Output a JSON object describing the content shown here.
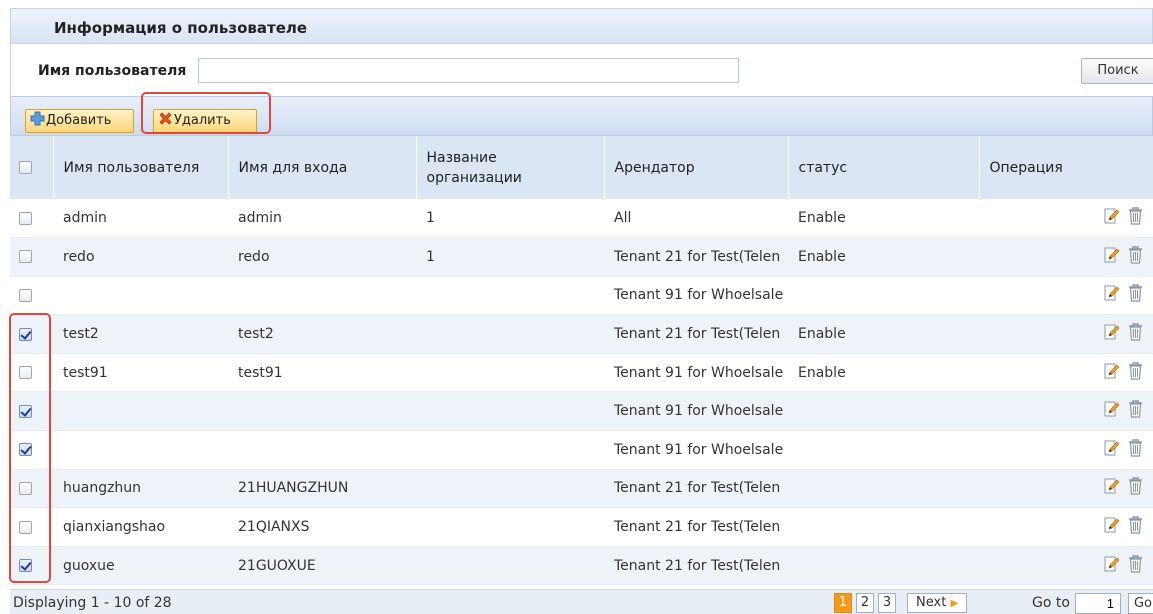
{
  "panel": {
    "title": "Информация о пользователе"
  },
  "search": {
    "label": "Имя пользователя",
    "value": "",
    "placeholder": "",
    "button": "Поиск"
  },
  "toolbar": {
    "add_label": "Добавить",
    "delete_label": "Удалить"
  },
  "columns": [
    "Имя пользователя",
    "Имя для входа",
    "Название организации",
    "Арендатор",
    "статус",
    "Операция"
  ],
  "rows": [
    {
      "checked": false,
      "name": "admin",
      "login": "admin",
      "org": "1",
      "tenant": "All",
      "status": "Enable"
    },
    {
      "checked": false,
      "name": "redo",
      "login": "redo",
      "org": "1",
      "tenant": "Tenant 21 for Test(Telen",
      "status": "Enable"
    },
    {
      "checked": false,
      "name": "",
      "login": "",
      "org": "",
      "tenant": "Tenant 91 for Whoelsale",
      "status": ""
    },
    {
      "checked": true,
      "name": "test2",
      "login": "test2",
      "org": "",
      "tenant": "Tenant 21 for Test(Telen",
      "status": "Enable"
    },
    {
      "checked": false,
      "name": "test91",
      "login": "test91",
      "org": "",
      "tenant": "Tenant 91 for Whoelsale",
      "status": "Enable"
    },
    {
      "checked": true,
      "name": "",
      "login": "",
      "org": "",
      "tenant": "Tenant 91 for Whoelsale",
      "status": ""
    },
    {
      "checked": true,
      "name": "",
      "login": "",
      "org": "",
      "tenant": "Tenant 91 for Whoelsale",
      "status": ""
    },
    {
      "checked": false,
      "name": "huangzhun",
      "login": "21HUANGZHUN",
      "org": "",
      "tenant": "Tenant 21 for Test(Telen",
      "status": ""
    },
    {
      "checked": false,
      "name": "qianxiangshao",
      "login": "21QIANXS",
      "org": "",
      "tenant": "Tenant 21 for Test(Telen",
      "status": ""
    },
    {
      "checked": true,
      "name": "guoxue",
      "login": "21GUOXUE",
      "org": "",
      "tenant": "Tenant 21 for Test(Telen",
      "status": ""
    }
  ],
  "footer": {
    "displaying": "Displaying 1 - 10 of 28",
    "pages": [
      "1",
      "2",
      "3"
    ],
    "current_page": "1",
    "next_label": "Next",
    "goto_label": "Go to",
    "goto_value": "1",
    "go_label": "Go"
  },
  "icons": {
    "edit": "edit-icon",
    "delete": "trash-icon",
    "add": "plus-icon",
    "remove": "x-icon",
    "next": "arrow-right-icon"
  },
  "colors": {
    "highlight": "#e2473b",
    "header_bg": "#dbe6f4",
    "button_bg": "#fbd677",
    "current_page": "#f49a1a"
  }
}
